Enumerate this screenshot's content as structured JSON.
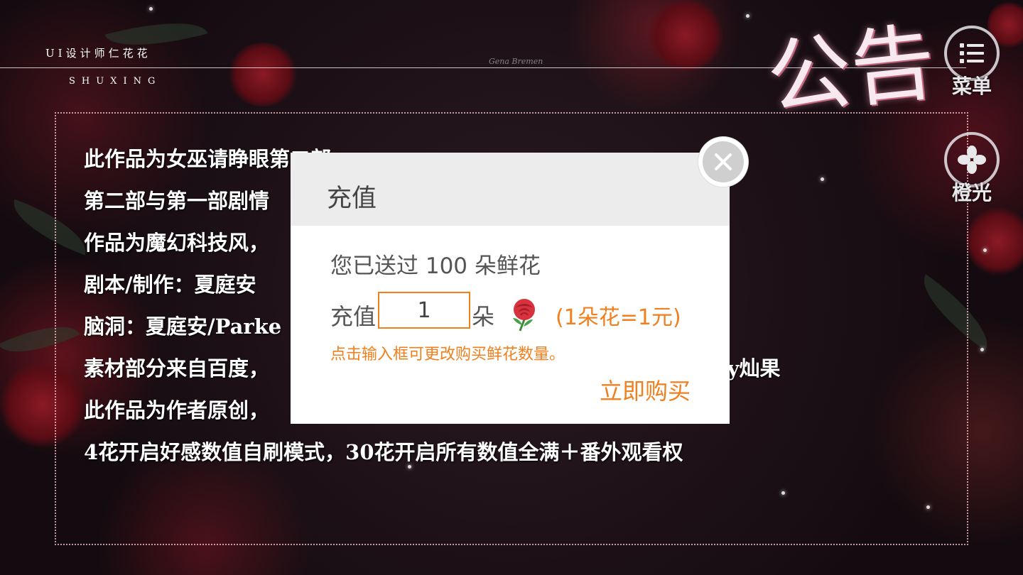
{
  "header": {
    "brand": "UI设计师仁花花",
    "brand_sub": "SHUXING",
    "signature": "Gena Bremen",
    "title_art": "公告"
  },
  "side_buttons": {
    "menu_label": "菜单",
    "orange_label": "橙光"
  },
  "notice": {
    "lines": [
      "此作品为女巫请睁眼第二部",
      "第二部与第一部剧情",
      "作品为魔幻科技风，",
      "剧本/制作：夏庭安",
      "脑洞：夏庭安/Parke",
      "素材部分来自百度，",
      "此作品为作者原创，",
      "4花开启好感数值自刷模式，30花开启所有数值全满＋番外观看权"
    ],
    "line6_tail": "cy灿果"
  },
  "dialog": {
    "title": "充值",
    "sent_text": "您已送过 100 朵鲜花",
    "qty_label": "充值",
    "qty_value": "1",
    "unit": "朵",
    "flower_icon": "rose-icon",
    "rate": "(1朵花=1元)",
    "hint": "点击输入框可更改购买鲜花数量。",
    "buy_label": "立即购买",
    "close_icon": "close-icon"
  },
  "colors": {
    "accent": "#f07f1e",
    "dialog_header": "#ececec"
  }
}
